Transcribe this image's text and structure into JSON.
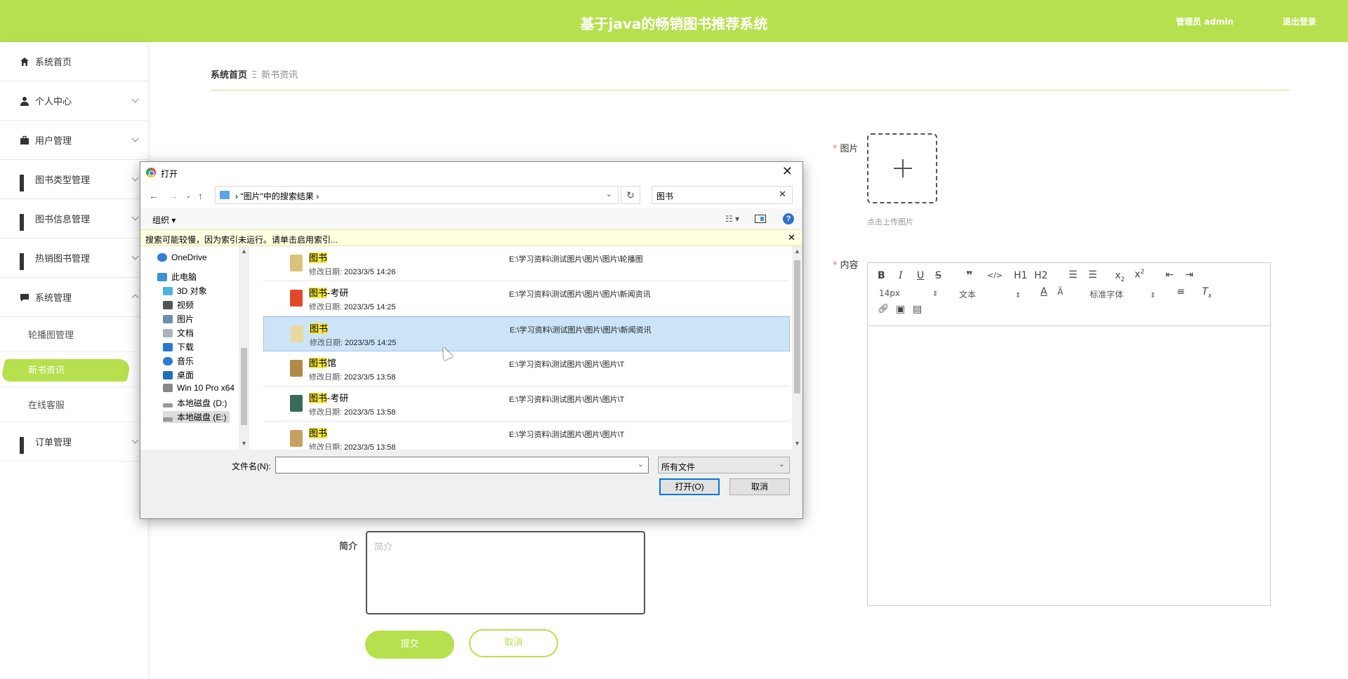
{
  "header": {
    "title": "基于java的畅销图书推荐系统",
    "user": "管理员 admin",
    "logout": "退出登录"
  },
  "sidebar": {
    "items": [
      {
        "label": "系统首页",
        "icon": "home-icon"
      },
      {
        "label": "个人中心",
        "icon": "user-icon"
      },
      {
        "label": "用户管理",
        "icon": "briefcase-icon"
      },
      {
        "label": "图书类型管理",
        "icon": "grid-icon"
      },
      {
        "label": "图书信息管理",
        "icon": "grid-icon"
      },
      {
        "label": "热销图书管理",
        "icon": "grid-icon"
      },
      {
        "label": "系统管理",
        "icon": "chat-icon"
      }
    ],
    "sub_items": [
      "轮播图管理",
      "新书资讯",
      "在线客服"
    ],
    "last_item": {
      "label": "订单管理",
      "icon": "grid-icon"
    },
    "accent": "#b6e04d"
  },
  "breadcrumb": {
    "home": "系统首页",
    "sep": "Ξ",
    "current": "新书资讯"
  },
  "form": {
    "pic_label": "图片",
    "upload_hint": "点击上传图片",
    "content_label": "内容",
    "intro_label": "简介",
    "intro_placeholder": "简介",
    "submit": "提交",
    "cancel": "取消"
  },
  "editor": {
    "font_size": "14px",
    "block_type": "文本",
    "font_family": "标准字体",
    "buttons": [
      "B",
      "I",
      "U",
      "S",
      "❞",
      "</>",
      "H1",
      "H2"
    ]
  },
  "dialog": {
    "title": "打开",
    "address": "\"图片\"中的搜索结果",
    "search_value": "图书",
    "organize": "组织 ▾",
    "info_text": "搜索可能较慢，因为索引未运行。请单击启用索引...",
    "tree": [
      "OneDrive",
      "此电脑",
      "3D 对象",
      "视频",
      "图片",
      "文档",
      "下载",
      "音乐",
      "桌面",
      "Win 10 Pro x64",
      "本地磁盘 (D:)",
      "本地磁盘 (E:)"
    ],
    "date_label": "修改日期:",
    "files": [
      {
        "hl": "图书",
        "rest": "",
        "date": "2023/3/5 14:26",
        "path": "E:\\学习资料\\测试图片\\图片\\图片\\轮播图",
        "color": "#d9c27a"
      },
      {
        "hl": "图书",
        "rest": "-考研",
        "date": "2023/3/5 14:25",
        "path": "E:\\学习资料\\测试图片\\图片\\图片\\新闻资讯",
        "color": "#e04a2a"
      },
      {
        "hl": "图书",
        "rest": "",
        "date": "2023/3/5 14:25",
        "path": "E:\\学习资料\\测试图片\\图片\\图片\\新闻资讯",
        "color": "#e8d9a0"
      },
      {
        "hl": "图书",
        "rest": "馆",
        "date": "2023/3/5 13:58",
        "path": "E:\\学习资料\\测试图片\\图片\\图片\\T",
        "color": "#b08a4a"
      },
      {
        "hl": "图书",
        "rest": "-考研",
        "date": "2023/3/5 13:58",
        "path": "E:\\学习资料\\测试图片\\图片\\图片\\T",
        "color": "#3a6a5a"
      },
      {
        "hl": "图书",
        "rest": "",
        "date": "2023/3/5 13:58",
        "path": "E:\\学习资料\\测试图片\\图片\\图片\\T",
        "color": "#c8a060"
      }
    ],
    "selected_index": 2,
    "filename_label": "文件名(N):",
    "filetype": "所有文件",
    "open_btn": "打开(O)",
    "cancel_btn": "取消"
  }
}
